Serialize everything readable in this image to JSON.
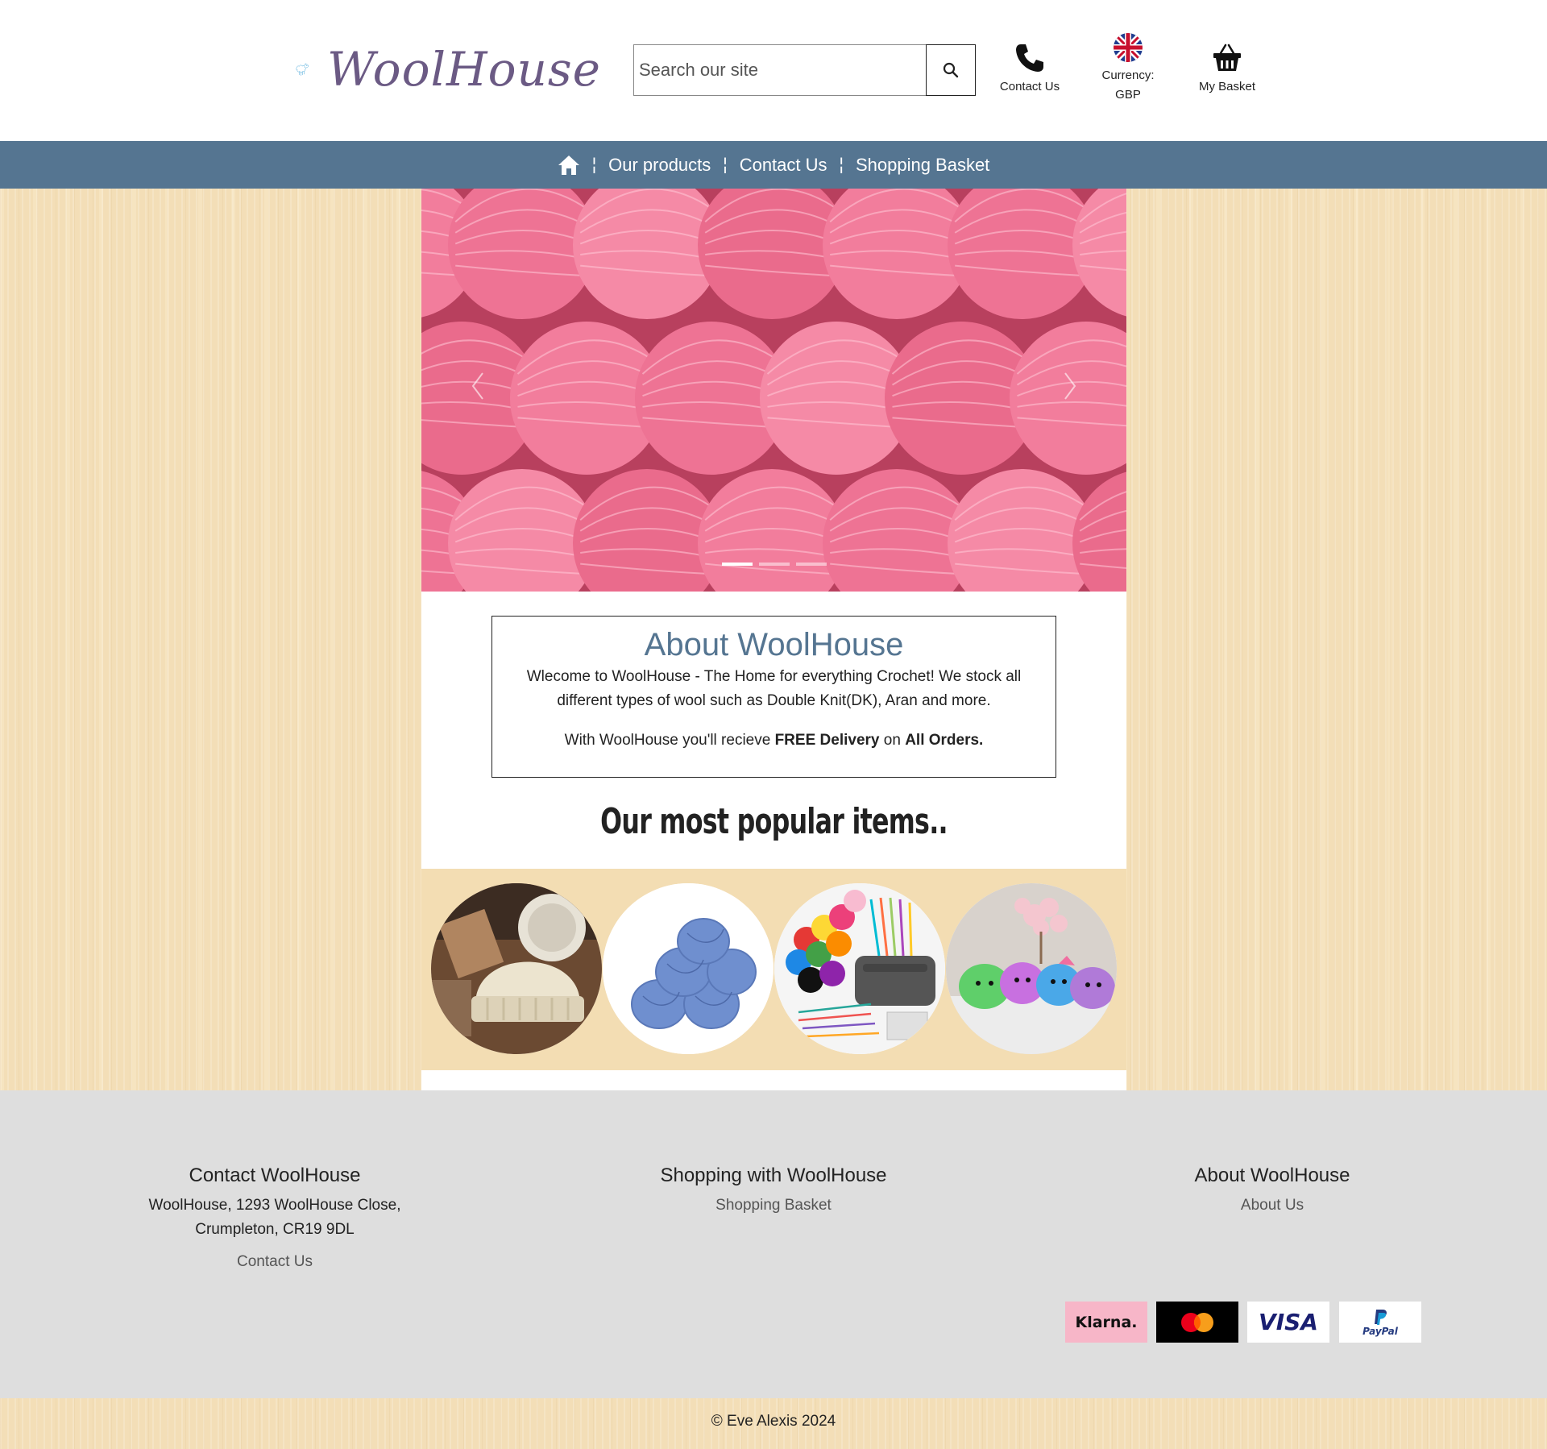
{
  "brand": {
    "name": "WoolHouse",
    "color": "#6b5a84",
    "accent": "#557591"
  },
  "search": {
    "placeholder": "Search our site",
    "value": "",
    "icon": "search-icon"
  },
  "header": {
    "contact_label": "Contact Us",
    "currency_label": "Currency:",
    "currency_value": "GBP",
    "basket_label": "My Basket"
  },
  "nav": {
    "home_icon": "home-icon",
    "items": [
      {
        "label": "Our products"
      },
      {
        "label": "Contact Us"
      },
      {
        "label": "Shopping Basket"
      }
    ]
  },
  "carousel": {
    "slide_count": 3,
    "active_slide": 1,
    "image": "pink yarn balls"
  },
  "about": {
    "title": "About WoolHouse",
    "text1": "Wlecome to WoolHouse - The Home for everything Crochet! We stock all different types of wool such as Double Knit(DK), Aran and more.",
    "text2_prefix": "With WoolHouse you'll recieve ",
    "text2_bold1": "FREE Delivery",
    "text2_mid": " on ",
    "text2_bold2": "All Orders."
  },
  "popular": {
    "title": "Our most popular items..",
    "items": [
      {
        "image": "cream knitted beanie hat"
      },
      {
        "image": "blue yarn balls"
      },
      {
        "image": "crochet starter kit with colourful yarn"
      },
      {
        "image": "crochet amigurumi toys"
      }
    ]
  },
  "footer": {
    "contact": {
      "title": "Contact WoolHouse",
      "address_line1": "WoolHouse, 1293 WoolHouse Close,",
      "address_line2": "Crumpleton, CR19 9DL",
      "link": "Contact Us"
    },
    "shopping": {
      "title": "Shopping with WoolHouse",
      "link": "Shopping Basket"
    },
    "about": {
      "title": "About WoolHouse",
      "link": "About Us"
    },
    "payments": [
      "Klarna.",
      "Mastercard",
      "VISA",
      "PayPal"
    ]
  },
  "copyright": "© Eve Alexis 2024"
}
